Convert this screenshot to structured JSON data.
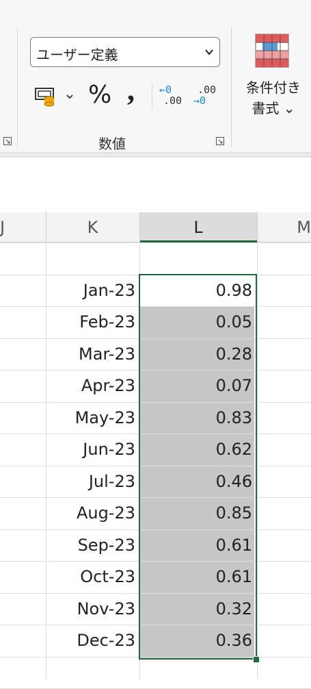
{
  "ribbon": {
    "number_format": {
      "selected": "ユーザー定義"
    },
    "percent_label": "%",
    "comma_label": ",",
    "increase_decimal": {
      "line1": "←0",
      "line2": ".00"
    },
    "decrease_decimal": {
      "line1": ".00",
      "line2": "→0"
    },
    "group_label": "数値",
    "conditional_format": {
      "line1": "条件付き",
      "line2": "書式 ⌄"
    },
    "accent_color": "#1e6b3a"
  },
  "grid": {
    "columns": [
      "J",
      "K",
      "L",
      "M"
    ],
    "selected_column": "L",
    "rows": [
      {
        "k": "",
        "l": ""
      },
      {
        "k": "Jan-23",
        "l": "0.98"
      },
      {
        "k": "Feb-23",
        "l": "0.05"
      },
      {
        "k": "Mar-23",
        "l": "0.28"
      },
      {
        "k": "Apr-23",
        "l": "0.07"
      },
      {
        "k": "May-23",
        "l": "0.83"
      },
      {
        "k": "Jun-23",
        "l": "0.62"
      },
      {
        "k": "Jul-23",
        "l": "0.46"
      },
      {
        "k": "Aug-23",
        "l": "0.85"
      },
      {
        "k": "Sep-23",
        "l": "0.61"
      },
      {
        "k": "Oct-23",
        "l": "0.61"
      },
      {
        "k": "Nov-23",
        "l": "0.32"
      },
      {
        "k": "Dec-23",
        "l": "0.36"
      }
    ]
  }
}
